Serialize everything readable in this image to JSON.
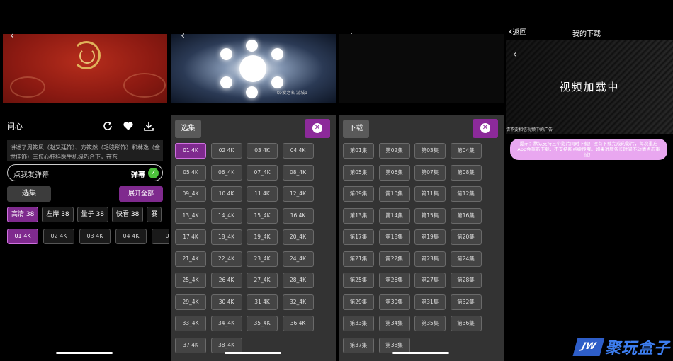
{
  "colors": {
    "accent": "#7f2a8e",
    "accent_border": "#d070e0",
    "sheet_bg": "#333333",
    "tip_bg": "#e9a7f0",
    "logo": "#3d7ef0"
  },
  "player": {
    "back_icon": "chevron-left-icon",
    "title": "问心",
    "icons": [
      "share-icon",
      "heart-icon",
      "download-icon"
    ],
    "description": "讲述了周筱风（赵又廷饰）、方筱然（毛晓彤饰）和林逸（金世佳饰）三位心脏科医生机缘巧合下，在东",
    "danmu_placeholder": "点我发弹幕",
    "danmu_label": "弹幕",
    "select_label": "选集",
    "expand_label": "展开全部",
    "sources": [
      "高清 38",
      "左岸 38",
      "量子 38",
      "快看 38",
      "暴"
    ],
    "active_source": 0,
    "episodes": [
      "01 4K",
      "02 4K",
      "03 4K",
      "04 4K",
      "0"
    ],
    "active_episode": 0
  },
  "episode_sheet": {
    "tab_label": "选集",
    "close_icon": "close-circle-icon",
    "watermark": "以·爱之名 游城1",
    "episodes": [
      "01 4K",
      "02 4K",
      "03 4K",
      "04 4K",
      "05 4K",
      "06_4K",
      "07_4K",
      "08_4K",
      "09_4K",
      "10 4K",
      "11 4K",
      "12_4K",
      "13_4K",
      "14_4K",
      "15_4K",
      "16 4K",
      "17 4K",
      "18_4K",
      "19_4K",
      "20_4K",
      "21_4K",
      "22_4K",
      "23_4K",
      "24_4K",
      "25_4K",
      "26 4K",
      "27_4K",
      "28_4K",
      "29_4K",
      "30 4K",
      "31 4K",
      "32_4K",
      "33_4K",
      "34_4K",
      "35_4K",
      "36 4K",
      "37 4K",
      "38_4K"
    ],
    "active_episode": 0
  },
  "download_sheet": {
    "tab_label": "下载",
    "close_icon": "close-circle-icon",
    "episodes": [
      "第01集",
      "第02集",
      "第03集",
      "第04集",
      "第05集",
      "第06集",
      "第07集",
      "第08集",
      "第09集",
      "第10集",
      "第11集",
      "第12集",
      "第13集",
      "第14集",
      "第15集",
      "第16集",
      "第17集",
      "第18集",
      "第19集",
      "第20集",
      "第21集",
      "第22集",
      "第23集",
      "第24集",
      "第25集",
      "第26集",
      "第27集",
      "第28集",
      "第29集",
      "第30集",
      "第31集",
      "第32集",
      "第33集",
      "第34集",
      "第35集",
      "第36集",
      "第37集",
      "第38集"
    ]
  },
  "downloads_page": {
    "back_label": "返回",
    "title": "我的下载",
    "loading_text": "视频加载中",
    "ad_note": "请不要相信视频中的广告",
    "tip": "提示：默认支持三个影片同时下载！没有下载完成的影片，每次重启App会重新下载，不支持断点续传哦。如果进度条长时间不动请点击重试！"
  },
  "watermark_logo": {
    "badge": "JW",
    "text": "聚玩盒子"
  }
}
